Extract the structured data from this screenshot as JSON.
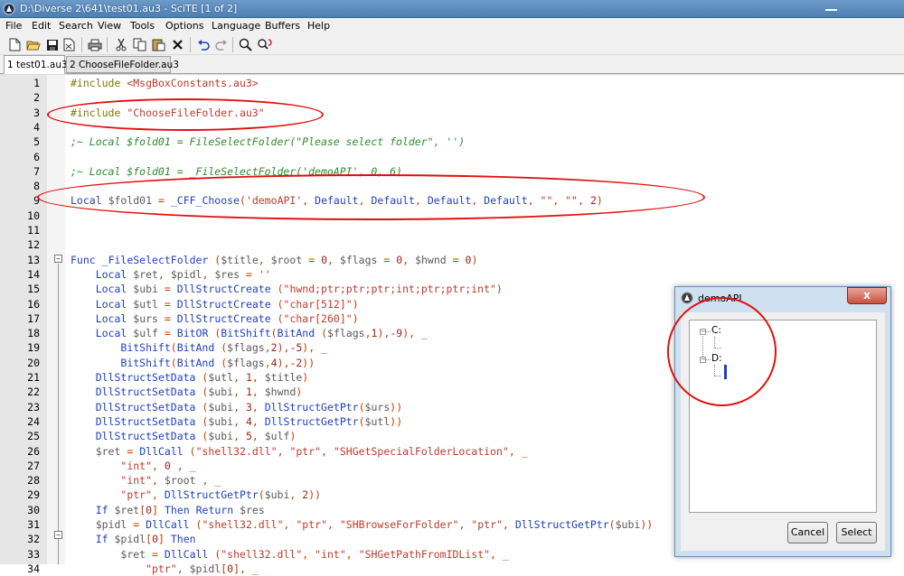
{
  "window": {
    "title": "D:\\Diverse 2\\641\\test01.au3 - SciTE [1 of 2]"
  },
  "menu": [
    "File",
    "Edit",
    "Search",
    "View",
    "Tools",
    "Options",
    "Language",
    "Buffers",
    "Help"
  ],
  "toolbar": [
    "new-icon",
    "open-icon",
    "save-icon",
    "close-file-icon",
    "print-icon",
    "cut-icon",
    "copy-icon",
    "paste-icon",
    "delete-icon",
    "undo-icon",
    "redo-icon",
    "find-icon",
    "replace-icon"
  ],
  "tabs": [
    {
      "label": "1 test01.au3",
      "active": true
    },
    {
      "label": "2 ChooseFileFolder.au3",
      "active": false
    }
  ],
  "editor": {
    "lines": [
      {
        "n": "1",
        "code": "#include <MsgBoxConstants.au3>"
      },
      {
        "n": "2",
        "code": ""
      },
      {
        "n": "3",
        "code": "#include \"ChooseFileFolder.au3\""
      },
      {
        "n": "4",
        "code": ""
      },
      {
        "n": "5",
        "code": ";~ Local $fold01 = FileSelectFolder(\"Please select folder\", '')"
      },
      {
        "n": "6",
        "code": ""
      },
      {
        "n": "7",
        "code": ";~ Local $fold01 = _FileSelectFolder('demoAPI', 0, 6)"
      },
      {
        "n": "8",
        "code": ""
      },
      {
        "n": "9",
        "code": "Local $fold01 = _CFF_Choose('demoAPI', Default, Default, Default, Default, \"\", \"\", 2)"
      },
      {
        "n": "10",
        "code": ""
      },
      {
        "n": "11",
        "code": ""
      },
      {
        "n": "12",
        "code": ""
      },
      {
        "n": "13",
        "code": "Func _FileSelectFolder ($title, $root = 0, $flags = 0, $hwnd = 0)"
      },
      {
        "n": "14",
        "code": "    Local $ret, $pidl, $res = ''"
      },
      {
        "n": "15",
        "code": "    Local $ubi = DllStructCreate (\"hwnd;ptr;ptr;ptr;int;ptr;ptr;int\")"
      },
      {
        "n": "16",
        "code": "    Local $utl = DllStructCreate (\"char[512]\")"
      },
      {
        "n": "17",
        "code": "    Local $urs = DllStructCreate (\"char[260]\")"
      },
      {
        "n": "18",
        "code": "    Local $ulf = BitOR (BitShift(BitAnd ($flags,1),-9), _"
      },
      {
        "n": "19",
        "code": "        BitShift(BitAnd ($flags,2),-5), _"
      },
      {
        "n": "20",
        "code": "        BitShift(BitAnd ($flags,4),-2))"
      },
      {
        "n": "21",
        "code": "    DllStructSetData ($utl, 1, $title)"
      },
      {
        "n": "22",
        "code": "    DllStructSetData ($ubi, 1, $hwnd)"
      },
      {
        "n": "23",
        "code": "    DllStructSetData ($ubi, 3, DllStructGetPtr($urs))"
      },
      {
        "n": "24",
        "code": "    DllStructSetData ($ubi, 4, DllStructGetPtr($utl))"
      },
      {
        "n": "25",
        "code": "    DllStructSetData ($ubi, 5, $ulf)"
      },
      {
        "n": "26",
        "code": "    $ret = DllCall (\"shell32.dll\", \"ptr\", \"SHGetSpecialFolderLocation\", _"
      },
      {
        "n": "27",
        "code": "        \"int\", 0 , _"
      },
      {
        "n": "28",
        "code": "        \"int\", $root , _"
      },
      {
        "n": "29",
        "code": "        \"ptr\", DllStructGetPtr($ubi, 2))"
      },
      {
        "n": "30",
        "code": "    If $ret[0] Then Return $res"
      },
      {
        "n": "31",
        "code": "    $pidl = DllCall (\"shell32.dll\", \"ptr\", \"SHBrowseForFolder\", \"ptr\", DllStructGetPtr($ubi))"
      },
      {
        "n": "32",
        "code": "    If $pidl[0] Then"
      },
      {
        "n": "33",
        "code": "        $ret = DllCall (\"shell32.dll\", \"int\", \"SHGetPathFromIDList\", _"
      },
      {
        "n": "34",
        "code": "            \"ptr\", $pidl[0], _"
      }
    ]
  },
  "dialog": {
    "title": "demoAPI",
    "close_label": "x",
    "tree": [
      {
        "label": "C:"
      },
      {
        "label": "D:"
      }
    ],
    "cancel_label": "Cancel",
    "select_label": "Select"
  },
  "colors": {
    "annotation": "#e01010",
    "titlebar": "#5a8abd"
  }
}
